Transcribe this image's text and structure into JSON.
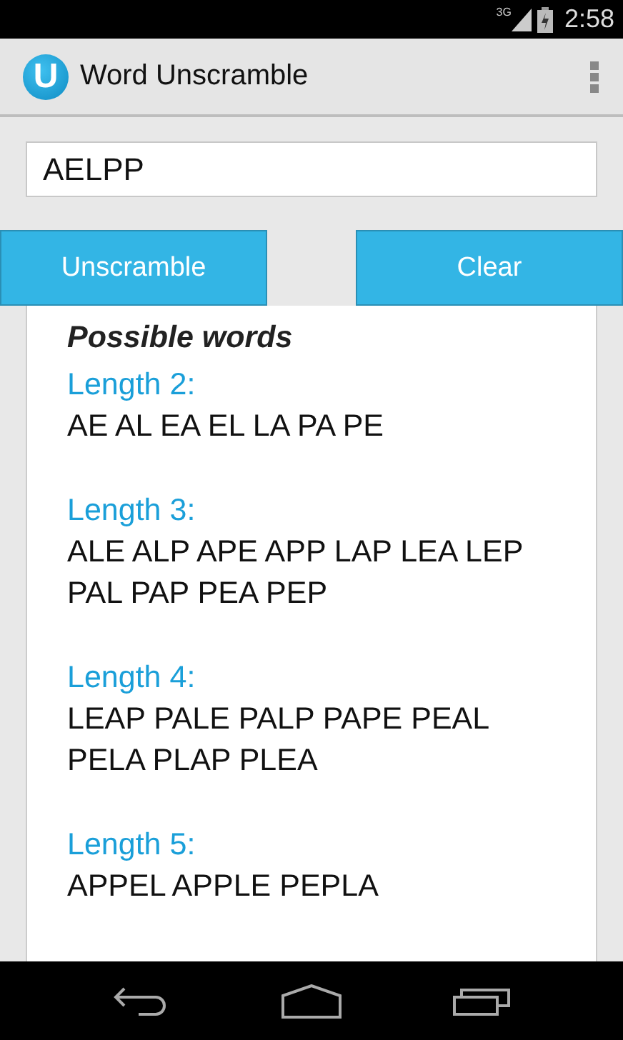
{
  "status_bar": {
    "network": "3G",
    "time": "2:58"
  },
  "action_bar": {
    "title": "Word Unscramble",
    "app_icon_letter": "U"
  },
  "input": {
    "value": "AELPP"
  },
  "buttons": [
    {
      "label": "Unscramble"
    },
    {
      "label": "Clear"
    }
  ],
  "results": {
    "heading": "Possible words",
    "groups": [
      {
        "title": "Length 2:",
        "words": "AE AL EA EL LA PA PE"
      },
      {
        "title": "Length 3:",
        "words": "ALE ALP APE APP LAP LEA LEP PAL PAP PEA PEP"
      },
      {
        "title": "Length 4:",
        "words": "LEAP PALE PALP PAPE PEAL PELA PLAP PLEA"
      },
      {
        "title": "Length 5:",
        "words": "APPEL APPLE PEPLA"
      }
    ]
  }
}
